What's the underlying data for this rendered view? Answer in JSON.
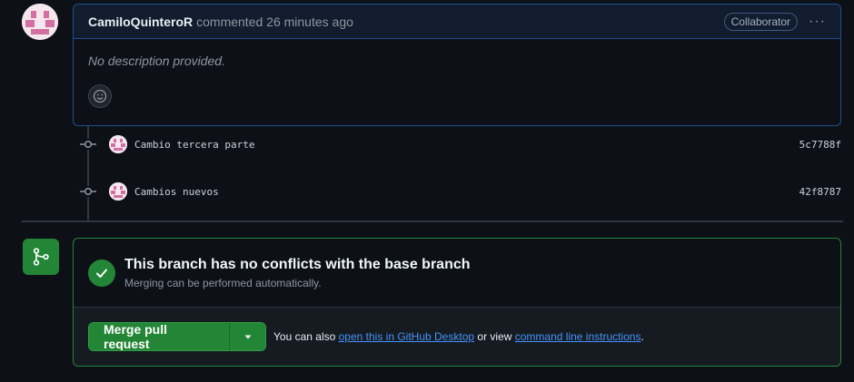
{
  "comment": {
    "author": "CamiloQuinteroR",
    "action": "commented 26 minutes ago",
    "badge": "Collaborator",
    "more_label": "···",
    "body": "No description provided."
  },
  "commits": [
    {
      "message": "Cambio tercera parte",
      "sha": "5c7788f"
    },
    {
      "message": "Cambios nuevos",
      "sha": "42f8787"
    }
  ],
  "merge": {
    "status_title": "This branch has no conflicts with the base branch",
    "status_sub": "Merging can be performed automatically.",
    "button_label": "Merge pull request",
    "also_prefix": "You can also",
    "desktop_link": "open this in GitHub Desktop",
    "or_view": "or view",
    "cli_link": "command line instructions",
    "period": "."
  },
  "colors": {
    "accent_green": "#238636",
    "link_blue": "#4493f8",
    "comment_border": "#1f4f8e"
  },
  "icons": {
    "avatar": "identicon",
    "smiley": "smiley-icon",
    "commit": "git-commit-icon",
    "merge": "git-merge-icon",
    "check": "check-icon",
    "caret": "triangle-down-icon"
  }
}
